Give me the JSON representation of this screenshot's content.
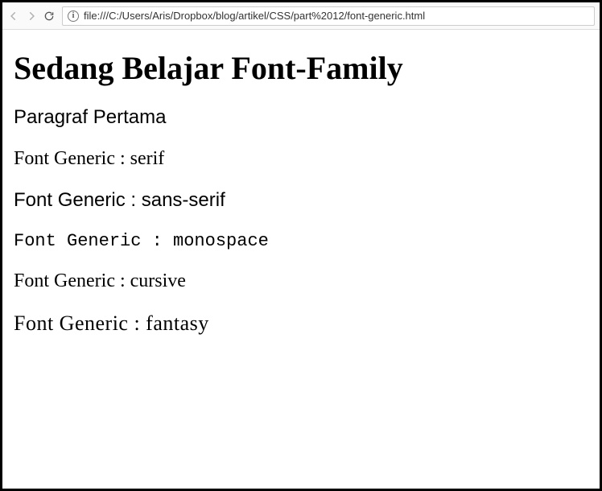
{
  "toolbar": {
    "url": "file:///C:/Users/Aris/Dropbox/blog/artikel/CSS/part%2012/font-generic.html"
  },
  "content": {
    "heading": "Sedang Belajar Font-Family",
    "p1": "Paragraf Pertama",
    "serif": "Font Generic : serif",
    "sans": "Font Generic : sans-serif",
    "mono": "Font Generic : monospace",
    "cursive": "Font Generic : cursive",
    "fantasy": "Font Generic : fantasy"
  }
}
